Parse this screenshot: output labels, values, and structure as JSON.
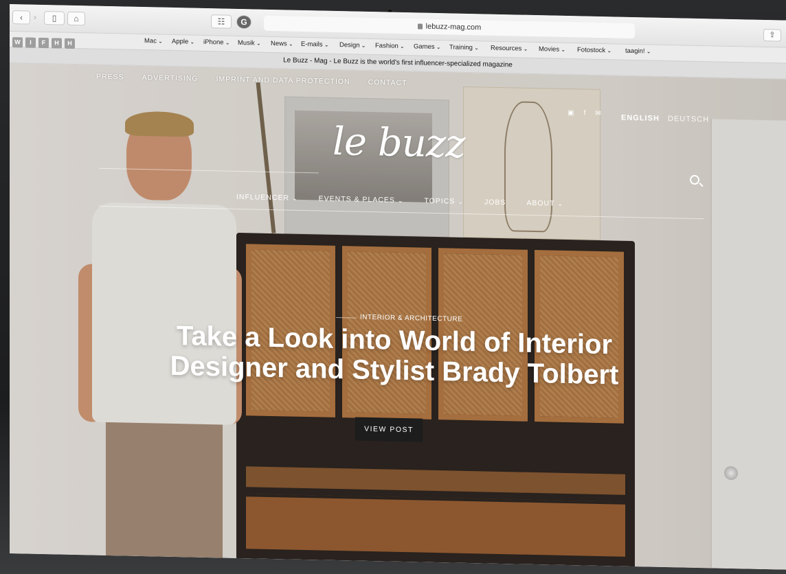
{
  "browser": {
    "url": "lebuzz-mag.com",
    "tab_title": "Le Buzz - Mag - Le Buzz is the world's first influencer-specialized magazine",
    "back_label": "‹",
    "forward_label": "›",
    "home_label": "⌂",
    "sidebar_label": "▯",
    "grid_label": "☷",
    "extension_label": "G",
    "share_label": "⇪",
    "favorites": [
      "Mac",
      "Apple",
      "iPhone",
      "Musik",
      "News",
      "E-mails",
      "Design",
      "Fashion",
      "Games",
      "Training",
      "Resources",
      "Movies",
      "Fotostock",
      "taagin!"
    ],
    "extension_buttons": [
      "W",
      "I",
      "F",
      "H",
      "H"
    ]
  },
  "site": {
    "top_nav": [
      "PRESS",
      "ADVERTISING",
      "IMPRINT AND DATA PROTECTION",
      "CONTACT"
    ],
    "social": {
      "instagram": "▣",
      "facebook": "f",
      "twitter": "✉"
    },
    "languages": {
      "english": "ENGLISH",
      "deutsch": "DEUTSCH"
    },
    "logo": "le buzz",
    "main_nav": [
      {
        "label": "INFLUENCER",
        "chevron": "⌄"
      },
      {
        "label": "EVENTS & PLACES",
        "chevron": "⌄"
      },
      {
        "label": "TOPICS",
        "chevron": "⌄"
      },
      {
        "label": "JOBS",
        "chevron": ""
      },
      {
        "label": "ABOUT",
        "chevron": "⌄"
      }
    ]
  },
  "hero": {
    "category": "INTERIOR & ARCHITECTURE",
    "headline": "Take a Look into World of Interior Designer and Stylist Brady Tolbert",
    "cta_label": "VIEW POST"
  }
}
